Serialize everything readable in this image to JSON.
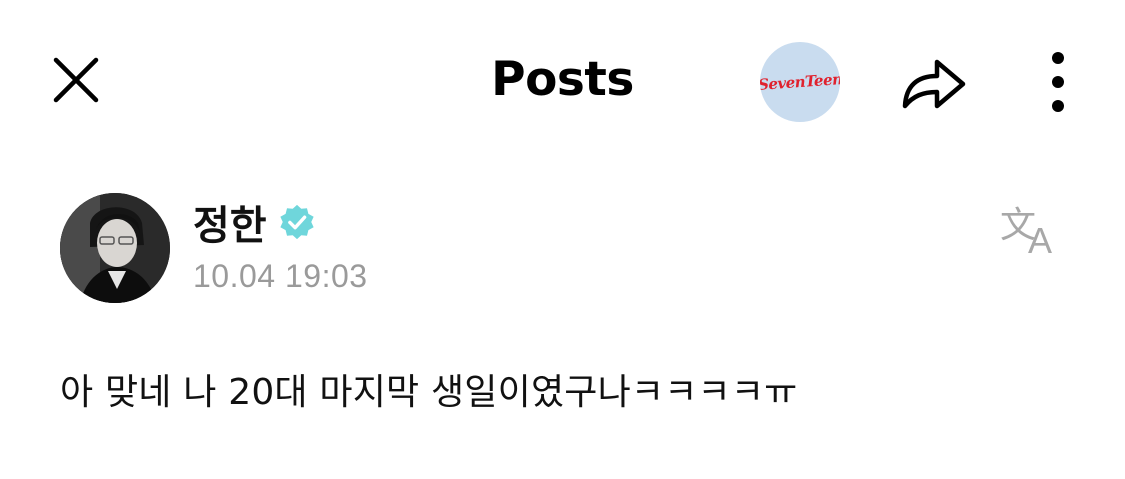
{
  "header": {
    "title": "Posts",
    "group_logo_text": "SevenTeen",
    "icons": {
      "close": "close-icon",
      "share": "share-icon",
      "more": "more-vertical-icon"
    }
  },
  "post": {
    "author_name": "정한",
    "verified_icon": "verified-badge-icon",
    "verified_color": "#6fd6db",
    "timestamp": "10.04 19:03",
    "translate_icon": "translate-icon",
    "text": "아 맞네 나 20대 마지막 생일이였구나ㅋㅋㅋㅋㅠ"
  }
}
